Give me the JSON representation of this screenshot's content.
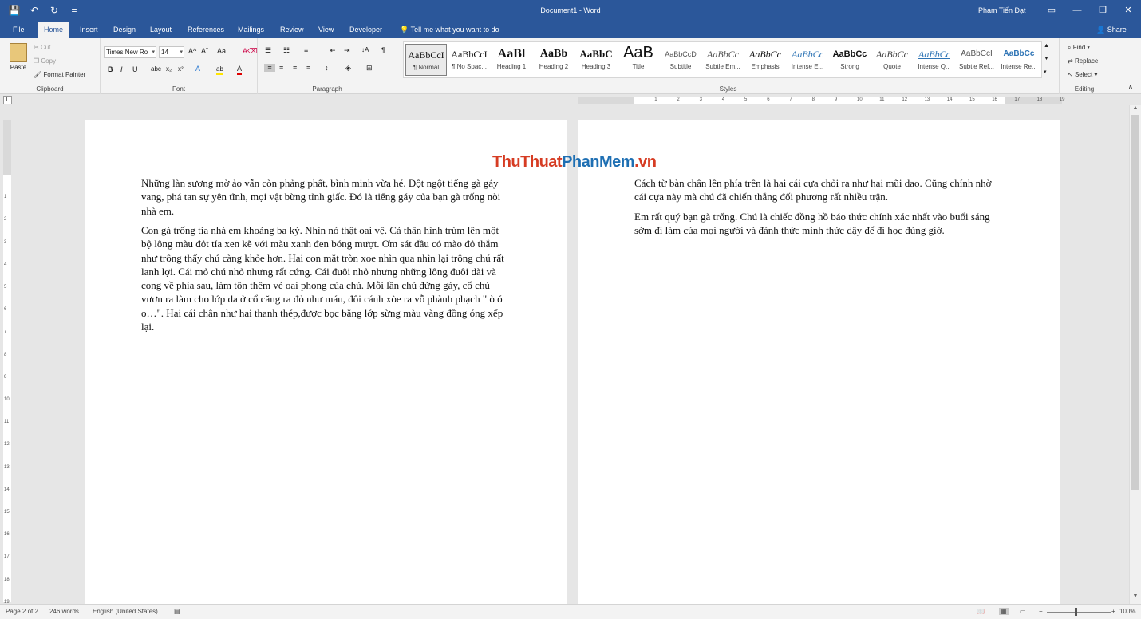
{
  "window": {
    "title": "Document1 - Word",
    "user": "Phạm Tiến Đạt",
    "qat": {
      "save_icon": "💾",
      "undo_icon": "↶",
      "redo_icon": "↻",
      "customize_icon": "="
    },
    "controls": {
      "ribbon_options": "▭",
      "minimize": "—",
      "restore": "❐",
      "close": "✕"
    }
  },
  "tabs": [
    "File",
    "Home",
    "Insert",
    "Design",
    "Layout",
    "References",
    "Mailings",
    "Review",
    "View",
    "Developer"
  ],
  "tell_me": "Tell me what you want to do",
  "share": "Share",
  "ribbon": {
    "clipboard": {
      "label": "Clipboard",
      "paste": "Paste",
      "cut": "Cut",
      "copy": "Copy",
      "format_painter": "Format Painter"
    },
    "font": {
      "label": "Font",
      "font_name": "Times New Ro",
      "font_size": "14",
      "bold": "B",
      "italic": "I",
      "underline": "U",
      "strike": "abc",
      "sub": "x₂",
      "sup": "x²",
      "grow": "A^",
      "shrink": "Aˇ",
      "case": "Aa",
      "clear": "A⌫",
      "effects": "A",
      "highlight": "ab",
      "color": "A"
    },
    "paragraph": {
      "label": "Paragraph",
      "sort": "↓A",
      "show_marks": "¶"
    },
    "styles": {
      "label": "Styles",
      "items": [
        {
          "preview": "AaBbCcI",
          "name": "¶ Normal"
        },
        {
          "preview": "AaBbCcI",
          "name": "¶ No Spac..."
        },
        {
          "preview": "AaBl",
          "name": "Heading 1"
        },
        {
          "preview": "AaBb",
          "name": "Heading 2"
        },
        {
          "preview": "AaBbC",
          "name": "Heading 3"
        },
        {
          "preview": "AaB",
          "name": "Title"
        },
        {
          "preview": "AaBbCcD",
          "name": "Subtitle"
        },
        {
          "preview": "AaBbCc",
          "name": "Subtle Em..."
        },
        {
          "preview": "AaBbCc",
          "name": "Emphasis"
        },
        {
          "preview": "AaBbCc",
          "name": "Intense E..."
        },
        {
          "preview": "AaBbCc",
          "name": "Strong"
        },
        {
          "preview": "AaBbCc",
          "name": "Quote"
        },
        {
          "preview": "AaBbCc",
          "name": "Intense Q..."
        },
        {
          "preview": "AaBbCcI",
          "name": "Subtle Ref..."
        },
        {
          "preview": "AaBbCc",
          "name": "Intense Re..."
        }
      ]
    },
    "editing": {
      "label": "Editing",
      "find": "Find",
      "replace": "Replace",
      "select": "Select"
    }
  },
  "ruler": {
    "numbers": [
      "1",
      "2",
      "3",
      "4",
      "5",
      "6",
      "7",
      "8",
      "9",
      "10",
      "11",
      "12",
      "13",
      "14",
      "15",
      "16",
      "17",
      "18",
      "19"
    ],
    "vnumbers": [
      "1",
      "2",
      "3",
      "4",
      "5",
      "6",
      "7",
      "8",
      "9",
      "10",
      "11",
      "12",
      "13",
      "14",
      "15",
      "16",
      "17",
      "18",
      "19"
    ]
  },
  "watermark": {
    "part1": "ThuThuat",
    "part2": "PhanMem",
    "part3": ".vn"
  },
  "document": {
    "page1": [
      "Những làn sương mờ ảo vẫn còn phảng phất, bình minh vừa hé. Đột ngột tiếng gà gáy vang, phá tan sự yên tĩnh, mọi vật bừng tỉnh giấc. Đó là tiếng gáy của bạn gà trống nòi nhà em.",
      "Con gà trống tía nhà em khoảng ba ký. Nhìn nó thật oai vệ. Cả thân hình trùm lên một bộ lông màu đỏt tía xen kẽ với màu xanh đen bóng mượt. Ơm sát đầu có mào đỏ thắm như trông thấy chú càng khỏe hơn. Hai con mắt tròn xoe nhìn qua nhìn lại trông chú rất lanh lợi. Cái mỏ chú nhỏ nhưng rất cứng. Cái đuôi nhỏ nhưng những lông đuôi dài và cong về phía sau, làm tôn thêm vẻ oai phong của chú. Mỗi lần chú đứng gáy, cổ chú vươn ra làm cho lớp da ở cổ căng ra đỏ như máu, đôi cánh xòe ra vỗ phành phạch \" ò ó o…\". Hai cái chân như hai thanh thép,được bọc bằng lớp sừng màu vàng đồng óng xếp lại."
    ],
    "page2": [
      "Cách từ bàn chân lên phía trên là hai cái cựa chỏi ra như hai mũi dao. Cũng chính nhờ cái cựa này mà chú đã chiến thắng đối phương rất nhiều trận.",
      "Em rất quý bạn gà trống. Chú là chiếc đồng hồ báo thức chính xác nhất vào buổi sáng sớm đi làm của mọi người và đánh thức mình thức dậy để đi học đúng giờ."
    ]
  },
  "status": {
    "page": "Page 2 of 2",
    "words": "246 words",
    "language": "English (United States)",
    "zoom": "100%",
    "zoom_level": 1.0
  }
}
